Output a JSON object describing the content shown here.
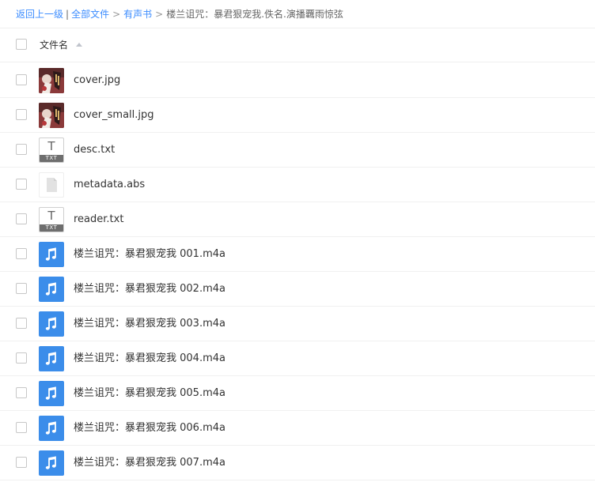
{
  "breadcrumb": {
    "back": "返回上一级",
    "pipe": "|",
    "all_files": "全部文件",
    "sep1": ">",
    "audiobooks": "有声书",
    "sep2": ">",
    "current": "楼兰诅咒：暴君狠宠我.佚名.演播覊雨惊弦"
  },
  "header": {
    "column_name": "文件名"
  },
  "files": [
    {
      "name": "cover.jpg",
      "icon": "image-thumbnail"
    },
    {
      "name": "cover_small.jpg",
      "icon": "image-thumbnail"
    },
    {
      "name": "desc.txt",
      "icon": "txt-file-icon",
      "glyph": "T",
      "band": "TXT"
    },
    {
      "name": "metadata.abs",
      "icon": "generic-file-icon"
    },
    {
      "name": "reader.txt",
      "icon": "txt-file-icon",
      "glyph": "T",
      "band": "TXT"
    },
    {
      "name": "楼兰诅咒：暴君狠宠我 001.m4a",
      "icon": "music-note-icon"
    },
    {
      "name": "楼兰诅咒：暴君狠宠我 002.m4a",
      "icon": "music-note-icon"
    },
    {
      "name": "楼兰诅咒：暴君狠宠我 003.m4a",
      "icon": "music-note-icon"
    },
    {
      "name": "楼兰诅咒：暴君狠宠我 004.m4a",
      "icon": "music-note-icon"
    },
    {
      "name": "楼兰诅咒：暴君狠宠我 005.m4a",
      "icon": "music-note-icon"
    },
    {
      "name": "楼兰诅咒：暴君狠宠我 006.m4a",
      "icon": "music-note-icon"
    },
    {
      "name": "楼兰诅咒：暴君狠宠我 007.m4a",
      "icon": "music-note-icon"
    }
  ],
  "colors": {
    "link": "#3b8cff",
    "audio_icon_bg": "#3b8dea",
    "divider": "#f0f0f0",
    "text": "#333333"
  }
}
